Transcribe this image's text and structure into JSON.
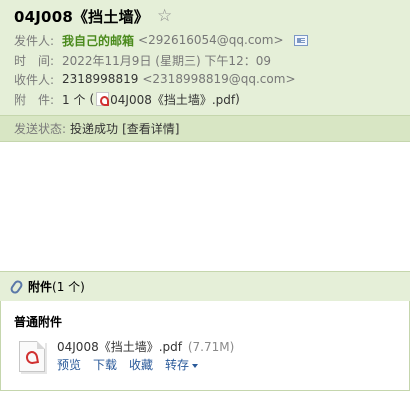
{
  "mail": {
    "subject": "04J008《挡土墙》",
    "sender_label": "发件人:",
    "sender_name": "我自己的邮箱",
    "sender_email": "<292616054@qq.com>",
    "time_label": "时　间:",
    "time_value": "2022年11月9日 (星期三) 下午12：09",
    "recipient_label": "收件人:",
    "recipient_name": "2318998819",
    "recipient_email": "<2318998819@qq.com>",
    "attachment_label": "附　件:",
    "attachment_count": "1 个",
    "attachment_paren_open": "(",
    "attachment_name": "04J008《挡土墙》.pdf",
    "attachment_paren_close": ")"
  },
  "status": {
    "label": "发送状态:",
    "value": "投递成功",
    "details_link": "[查看详情]"
  },
  "attachments": {
    "title": "附件",
    "count": "(1 个)",
    "section_title": "普通附件",
    "file_name": "04J008《挡土墙》.pdf",
    "file_size": "(7.71M)",
    "actions": [
      "预览",
      "下载",
      "收藏",
      "转存"
    ]
  },
  "icons": {
    "star": "star-icon",
    "contact_card": "contact-card-icon",
    "pdf": "pdf-icon",
    "paperclip": "paperclip-icon",
    "dropdown": "chevron-down-icon"
  },
  "colors": {
    "header_bg": "#e5efd8",
    "status_bg": "#d8e6c4",
    "sender_green": "#4a8a1c",
    "link_blue": "#2a5a9a"
  }
}
